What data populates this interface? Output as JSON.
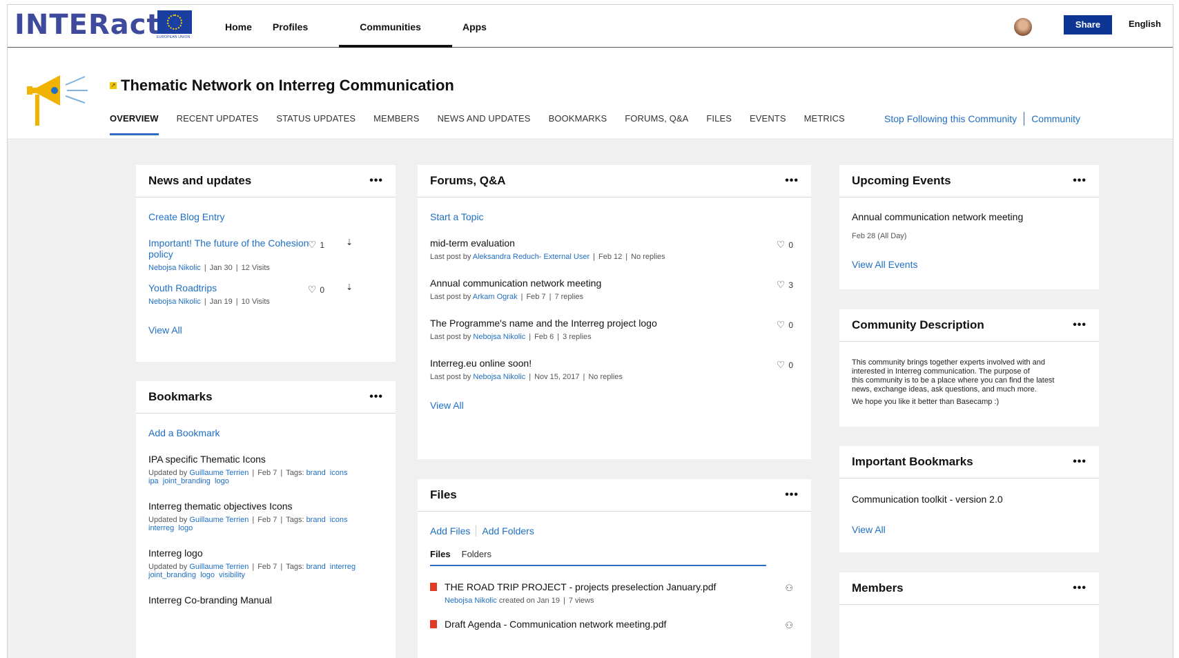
{
  "topbar": {
    "logo": "INTERact",
    "eu_label": "EUROPEAN UNION",
    "nav": [
      "Home",
      "Profiles",
      "Communities",
      "Apps"
    ],
    "share_label": "Share",
    "language": "English"
  },
  "community": {
    "title": "Thematic Network on Interreg Communication",
    "tabs": [
      "OVERVIEW",
      "RECENT UPDATES",
      "STATUS UPDATES",
      "MEMBERS",
      "NEWS AND UPDATES",
      "BOOKMARKS",
      "FORUMS, Q&A",
      "FILES",
      "EVENTS",
      "METRICS"
    ],
    "stop_following": "Stop Following this Community",
    "community_link": "Community"
  },
  "news": {
    "title": "News and updates",
    "menu": "•••",
    "create": "Create Blog Entry",
    "items": [
      {
        "title": "Important! The future of the Cohesion policy",
        "author": "Nebojsa Nikolic",
        "date": "Jan 30",
        "visits": "12 Visits",
        "likes": "1"
      },
      {
        "title": "Youth Roadtrips",
        "author": "Nebojsa Nikolic",
        "date": "Jan 19",
        "visits": "10 Visits",
        "likes": "0"
      }
    ],
    "view_all": "View All"
  },
  "bookmarks": {
    "title": "Bookmarks",
    "menu": "•••",
    "add": "Add a Bookmark",
    "updated_by": "Updated by",
    "tags_label": "Tags:",
    "items": [
      {
        "title": "IPA specific Thematic Icons",
        "author": "Guillaume Terrien",
        "date": "Feb 7",
        "tags_line1": "brand  icons",
        "tags_line2": "ipa  joint_branding  logo"
      },
      {
        "title": "Interreg thematic objectives Icons",
        "author": "Guillaume Terrien",
        "date": "Feb 7",
        "tags_line1": "brand  icons",
        "tags_line2": "interreg  logo"
      },
      {
        "title": "Interreg logo",
        "author": "Guillaume Terrien",
        "date": "Feb 7",
        "tags_line1": "brand  interreg",
        "tags_line2": "joint_branding  logo  visibility"
      },
      {
        "title": "Interreg Co-branding Manual"
      }
    ]
  },
  "forums": {
    "title": "Forums, Q&A",
    "menu": "•••",
    "start": "Start a Topic",
    "last_post_by": "Last post by",
    "items": [
      {
        "title": "mid-term evaluation",
        "author": "Aleksandra Reduch- External User",
        "date": "Feb 12",
        "replies": "No replies",
        "likes": "0"
      },
      {
        "title": "Annual communication network meeting",
        "author": "Arkam Ograk",
        "date": "Feb 7",
        "replies": "7 replies",
        "likes": "3"
      },
      {
        "title": "The Programme's name and the Interreg project logo",
        "author": "Nebojsa Nikolic",
        "date": "Feb 6",
        "replies": "3 replies",
        "likes": "0"
      },
      {
        "title": "Interreg.eu online soon!",
        "author": "Nebojsa Nikolic",
        "date": "Nov 15, 2017",
        "replies": "No replies",
        "likes": "0"
      }
    ],
    "view_all": "View All"
  },
  "files": {
    "title": "Files",
    "menu": "•••",
    "add_files": "Add Files",
    "add_folders": "Add Folders",
    "tab_files": "Files",
    "tab_folders": "Folders",
    "created_on": "created on",
    "items": [
      {
        "name": "THE ROAD TRIP PROJECT - projects preselection January.pdf",
        "author": "Nebojsa Nikolic",
        "date": "Jan 19",
        "views": "7 views"
      },
      {
        "name": "Draft Agenda - Communication network meeting.pdf"
      }
    ]
  },
  "events": {
    "title": "Upcoming Events",
    "menu": "•••",
    "event_name": "Annual communication network meeting",
    "event_date": "Feb 28 (All Day)",
    "view_all": "View All Events"
  },
  "description": {
    "title": "Community Description",
    "menu": "•••",
    "lines": [
      "This community brings together experts involved with and",
      "interested in Interreg communication. The purpose of",
      "this community is to be a place where you can find the latest",
      "news, exchange ideas, ask questions, and much more."
    ],
    "closing": "We hope you like it better than Basecamp :)"
  },
  "important": {
    "title": "Important Bookmarks",
    "menu": "•••",
    "item": "Communication toolkit - version 2.0",
    "view_all": "View All"
  },
  "members": {
    "title": "Members",
    "menu": "•••"
  }
}
